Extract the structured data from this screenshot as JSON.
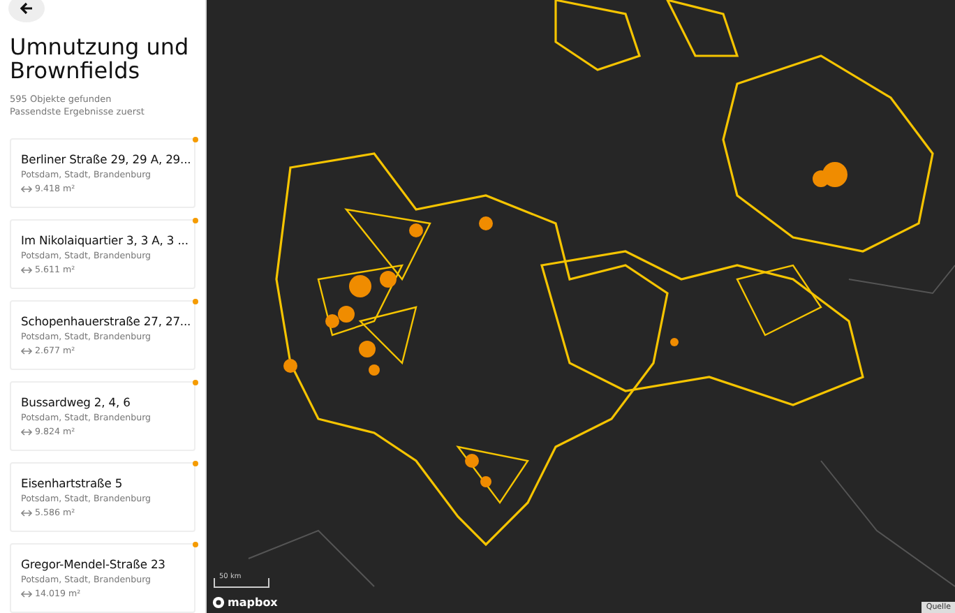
{
  "sidebar": {
    "title": "Umnutzung und Brownfields",
    "result_count": "595 Objekte gefunden",
    "sort_note": "Passendste Ergebnisse zuerst",
    "results": [
      {
        "address": "Berliner Straße 29, 29 A, 29...",
        "location": "Potsdam, Stadt, Brandenburg",
        "area": "9.418 m²"
      },
      {
        "address": "Im Nikolaiquartier 3, 3 A, 3 ...",
        "location": "Potsdam, Stadt, Brandenburg",
        "area": "5.611 m²"
      },
      {
        "address": "Schopenhauerstraße 27, 27...",
        "location": "Potsdam, Stadt, Brandenburg",
        "area": "2.677 m²"
      },
      {
        "address": "Bussardweg 2, 4, 6",
        "location": "Potsdam, Stadt, Brandenburg",
        "area": "9.824 m²"
      },
      {
        "address": "Eisenhartstraße 5",
        "location": "Potsdam, Stadt, Brandenburg",
        "area": "5.586 m²"
      },
      {
        "address": "Gregor-Mendel-Straße 23",
        "location": "Potsdam, Stadt, Brandenburg",
        "area": "14.019 m²"
      }
    ]
  },
  "map": {
    "scale_label": "50 km",
    "logo_text": "mapbox",
    "attribution": "Quelle"
  }
}
